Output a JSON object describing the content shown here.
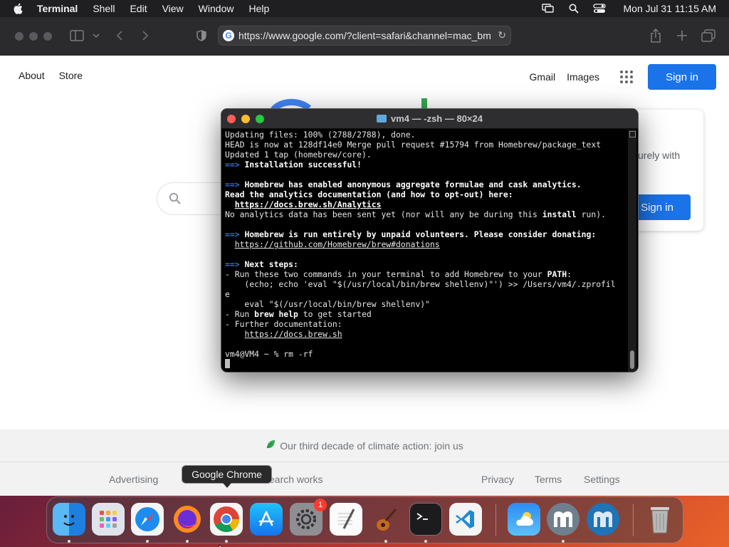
{
  "menubar": {
    "app": "Terminal",
    "items": [
      "Shell",
      "Edit",
      "View",
      "Window",
      "Help"
    ],
    "clock": "Mon Jul 31  11:15 AM",
    "icons": [
      "apple-icon",
      "screen-mirror-icon",
      "spotlight-icon",
      "control-center-icon"
    ]
  },
  "safari": {
    "url": "https://www.google.com/?client=safari&channel=mac_bm",
    "accent": "#1a73e8"
  },
  "google": {
    "nav_left": [
      "About",
      "Store"
    ],
    "gmail": "Gmail",
    "images": "Images",
    "signin": "Sign in",
    "promo_text": "urely with",
    "promo_signin": "Sign in",
    "footer_climate": "Our third decade of climate action: join us",
    "footer_advertising": "Advertising",
    "footer_search_works": "earch works",
    "footer_privacy": "Privacy",
    "footer_terms": "Terms",
    "footer_settings": "Settings"
  },
  "terminal": {
    "title": "vm4 — -zsh — 80×24",
    "lines": {
      "l1": "Updating files: 100% (2788/2788), done.",
      "l2": "HEAD is now at 128df14e0 Merge pull request #15794 from Homebrew/package_text",
      "l3": "Updated 1 tap (homebrew/core).",
      "arrow": "==>",
      "l4": "Installation successful!",
      "l6": "Homebrew has enabled anonymous aggregate formulae and cask analytics.",
      "l7": "Read the analytics documentation (and how to opt-out) here:",
      "l8_link": "https://docs.brew.sh/Analytics",
      "l9a": "No analytics data has been sent yet (nor will any be during this ",
      "l9b": "install",
      "l9c": " run).",
      "l11": "Homebrew is run entirely by unpaid volunteers. Please consider donating:",
      "l12_link": "https://github.com/Homebrew/brew#donations",
      "l14": "Next steps:",
      "l15a": "- Run these two commands in your terminal to add Homebrew to your ",
      "l15b": "PATH",
      "l15c": ":",
      "l16": "    (echo; echo 'eval \"$(/usr/local/bin/brew shellenv)\"') >> /Users/vm4/.zprofil",
      "l17": "e",
      "l18": "    eval \"$(/usr/local/bin/brew shellenv)\"",
      "l19a": "- Run ",
      "l19b": "brew help",
      "l19c": " to get started",
      "l20": "- Further documentation:",
      "l21_link": "https://docs.brew.sh",
      "l23": "vm4@VM4 ~ % rm -rf"
    }
  },
  "dock": {
    "tooltip": "Google Chrome",
    "settings_badge": "1",
    "apps": [
      "finder",
      "launchpad",
      "safari",
      "firefox",
      "chrome",
      "app-store",
      "system-settings",
      "textedit",
      "garageband",
      "terminal",
      "vscode",
      "weather",
      "mysql-workbench",
      "mysql-workbench-2",
      "trash"
    ]
  }
}
